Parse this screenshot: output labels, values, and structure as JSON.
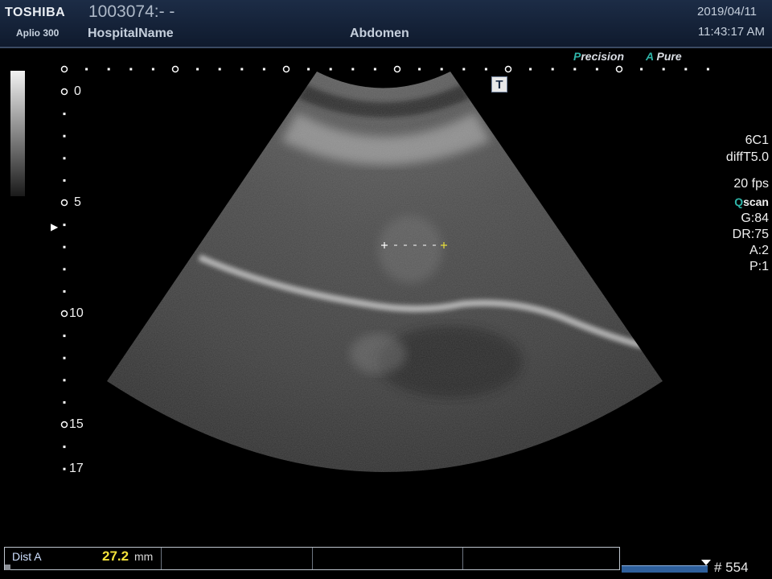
{
  "header": {
    "brand": "TOSHIBA",
    "model": "Aplio 300",
    "patient_id": "1003074:- -",
    "hospital": "HospitalName",
    "exam": "Abdomen",
    "date": "2019/04/11",
    "time": "11:43:17 AM"
  },
  "image_modes": {
    "precision_q": "P",
    "precision_rest": "recision",
    "apure_q": "A",
    "apure_rest": "Pure"
  },
  "body_marker": "T",
  "depth_scale": {
    "labels": [
      "0",
      "5",
      "10",
      "15",
      "17"
    ]
  },
  "params": {
    "probe": "6C1",
    "preset": "diffT5.0",
    "fps": "20 fps",
    "qscan_q": "Q",
    "qscan_rest": "scan",
    "gain": "G:84",
    "dr": "DR:75",
    "a": "A:2",
    "p": "P:1"
  },
  "measurement": {
    "label": "Dist A",
    "value": "27.2",
    "unit": "mm"
  },
  "cine": {
    "frame": "# 554",
    "position": 0.95
  },
  "colors": {
    "header_bg": "#16223a",
    "accent_teal": "#2fb4a8",
    "measure_value": "#f4e23a",
    "caliper": "#e8df3a"
  }
}
